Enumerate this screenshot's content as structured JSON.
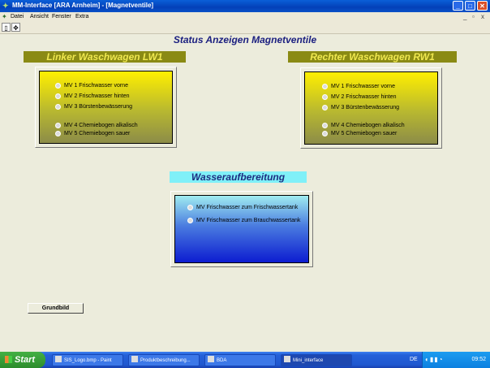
{
  "window": {
    "title": "MM-Interface [ARA Arnheim] - [Magnetventile]"
  },
  "menu": [
    "Datei",
    "Ansicht",
    "Fenster",
    "Extra"
  ],
  "page_title": "Status Anzeigen Magnetventile",
  "left_panel": {
    "title": "Linker Waschwagen  LW1",
    "items": [
      "MV 1 Frischwasser vorne",
      "MV 2 Frischwasser hinten",
      "MV 3 Bürstenbewässerung",
      "MV 4 Chemiebogen alkalisch",
      "MV 5 Chemiebogen sauer"
    ]
  },
  "right_panel": {
    "title": "Rechter Waschwagen RW1",
    "items": [
      "MV 1 Frischwasser vorne",
      "MV 2 Frischwasser hinten",
      "MV 3 Bürstenbewässerung",
      "MV 4 Chemiebogen alkalisch",
      "MV 5 Chemiebogen sauer"
    ]
  },
  "water_panel": {
    "title": "Wasseraufbereitung",
    "items": [
      "MV Frischwasser zum Frischwassertank",
      "MV Frischwasser zum Brauchwassertank"
    ]
  },
  "grundbild_label": "Grundbild",
  "taskbar": {
    "start_label": "Start",
    "tasks": [
      "SIS_Logo.bmp - Paint",
      "Produktbeschreibung...",
      "BDA",
      "Mini_interface"
    ],
    "language": "DE",
    "clock": "09:52"
  },
  "colors": {
    "title_blue": "#1c2080",
    "header_olive": "#8a8a14",
    "header_yellow_text": "#f0e850",
    "header_cyan": "#80f0f8"
  }
}
